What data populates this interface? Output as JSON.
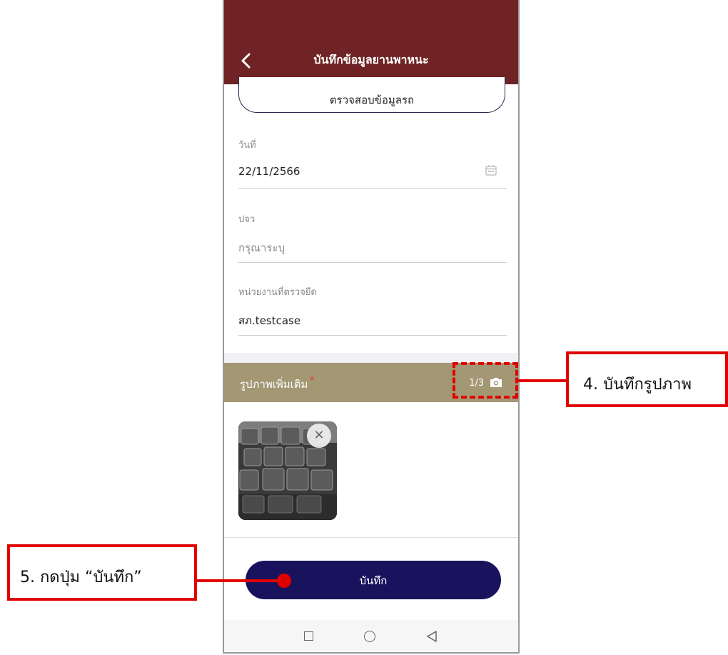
{
  "header": {
    "title": "บันทึกข้อมูลยานพาหนะ"
  },
  "check_button": {
    "label": "ตรวจสอบข้อมูลรถ"
  },
  "fields": {
    "date": {
      "label": "วันที่",
      "value": "22/11/2566"
    },
    "pcv": {
      "label": "ปจว",
      "placeholder": "กรุณาระบุ"
    },
    "unit": {
      "label": "หน่วยงานที่ตรวจยึด",
      "value": "สภ.testcase"
    }
  },
  "photos": {
    "label": "รูปภาพเพิ่มเติม",
    "required_mark": "*",
    "count": "1/3"
  },
  "save_button": {
    "label": "บันทึก"
  },
  "annotations": {
    "step4": "4. บันทึกรูปภาพ",
    "step5": "5. กดปุ่ม “บันทึก”"
  },
  "colors": {
    "appbar": "#6f2324",
    "photo_bar": "#a39774",
    "save_button": "#19135d",
    "annotation": "#e10000"
  }
}
